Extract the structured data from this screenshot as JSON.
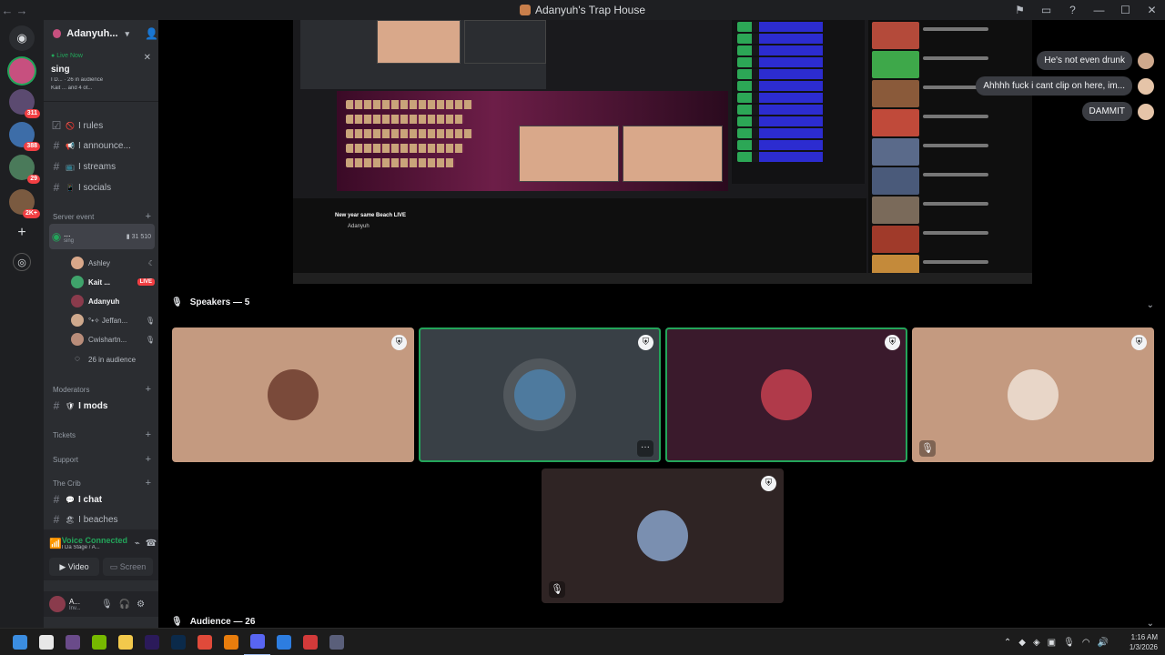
{
  "window": {
    "title": "Adanyuh's Trap House",
    "back_icon": "back-arrow-icon",
    "forward_icon": "forward-arrow-icon"
  },
  "server_rail": {
    "badges": [
      "311",
      "388",
      "29",
      "2K+"
    ]
  },
  "guild": {
    "name": "Adanyuh..."
  },
  "live_now": {
    "label": "Live Now",
    "stage_name": "sing",
    "line1": "I D... · 26 in audience",
    "line2": "Kait ... and 4 ot..."
  },
  "channels": [
    {
      "name": "I rules",
      "emoji": "🚫"
    },
    {
      "name": "I announce...",
      "emoji": "📢"
    },
    {
      "name": "I streams",
      "emoji": "📺"
    },
    {
      "name": "I socials",
      "emoji": "📱"
    }
  ],
  "server_event": {
    "label": "Server event",
    "stage_channel": "...",
    "stage_topic": "sing",
    "video_count": "31",
    "listener_count": "510"
  },
  "voice_users": [
    {
      "name": "Ashley",
      "color": "#d9a88a"
    },
    {
      "name": "Kait ...",
      "color": "#3fa36b",
      "live": "LIVE"
    },
    {
      "name": "Adanyuh",
      "color": "#8a3b4c"
    },
    {
      "name": "°•✧ Jeffan...",
      "color": "#cfa98d"
    },
    {
      "name": "Cwishartn...",
      "color": "#b98d7a"
    },
    {
      "name": "26 in audience",
      "color": "#1e1f22"
    }
  ],
  "categories": {
    "moderators": "Moderators",
    "mods_channel": "I mods",
    "tickets": "Tickets",
    "support": "Support",
    "the_crib": "The Crib",
    "chat_channel": "I chat",
    "beaches_channel": "I beaches"
  },
  "voice_panel": {
    "status": "Voice Connected",
    "location": "I Da Stage / A...",
    "video_label": "Video",
    "screen_label": "Screen"
  },
  "user_panel": {
    "name": "A...",
    "sub": "Inv..."
  },
  "stream": {
    "video_title": "New year same Beach LIVE",
    "channel": "Adanyuh"
  },
  "chat_bubbles": [
    "He's not even drunk",
    "Ahhhh fuck i cant clip on here, im...",
    "DAMMIT"
  ],
  "speakers": {
    "label": "Speakers — 5",
    "tiles": [
      {
        "bg": "#c49a80",
        "avatar": "#7a4a3a",
        "speaking": false,
        "muted": false
      },
      {
        "bg": "#394046",
        "avatar": "#4e7a9e",
        "speaking": true,
        "muted": false,
        "more": "···"
      },
      {
        "bg": "#3a1a2c",
        "avatar": "#b03a4a",
        "speaking": true,
        "muted": false
      },
      {
        "bg": "#c49a80",
        "avatar": "#e8d6c8",
        "speaking": false,
        "muted": true
      },
      {
        "bg": "#2f2424",
        "avatar": "#7a8fb0",
        "speaking": false,
        "muted": true
      }
    ]
  },
  "audience": {
    "label": "Audience — 26"
  },
  "taskbar": {
    "time": "1:16 AM",
    "date": "1/3/2026",
    "apps": [
      {
        "name": "windows-start-icon",
        "color": "#3b8de0"
      },
      {
        "name": "file-icon",
        "color": "#e8e8e8"
      },
      {
        "name": "photo-editor-icon",
        "color": "#6a4b8a"
      },
      {
        "name": "nvidia-icon",
        "color": "#76b900"
      },
      {
        "name": "file-explorer-icon",
        "color": "#f2c94c"
      },
      {
        "name": "premiere-pro-icon",
        "color": "#2b1a5a"
      },
      {
        "name": "photoshop-icon",
        "color": "#0b2a4a"
      },
      {
        "name": "chrome-icon",
        "color": "#e04a3a"
      },
      {
        "name": "blender-icon",
        "color": "#e87d0d"
      },
      {
        "name": "discord-icon",
        "color": "#5865f2"
      },
      {
        "name": "app-blue-icon",
        "color": "#2d7de0"
      },
      {
        "name": "recorder-icon",
        "color": "#d23a3a"
      },
      {
        "name": "app-gray-icon",
        "color": "#5a5f7a"
      }
    ]
  }
}
